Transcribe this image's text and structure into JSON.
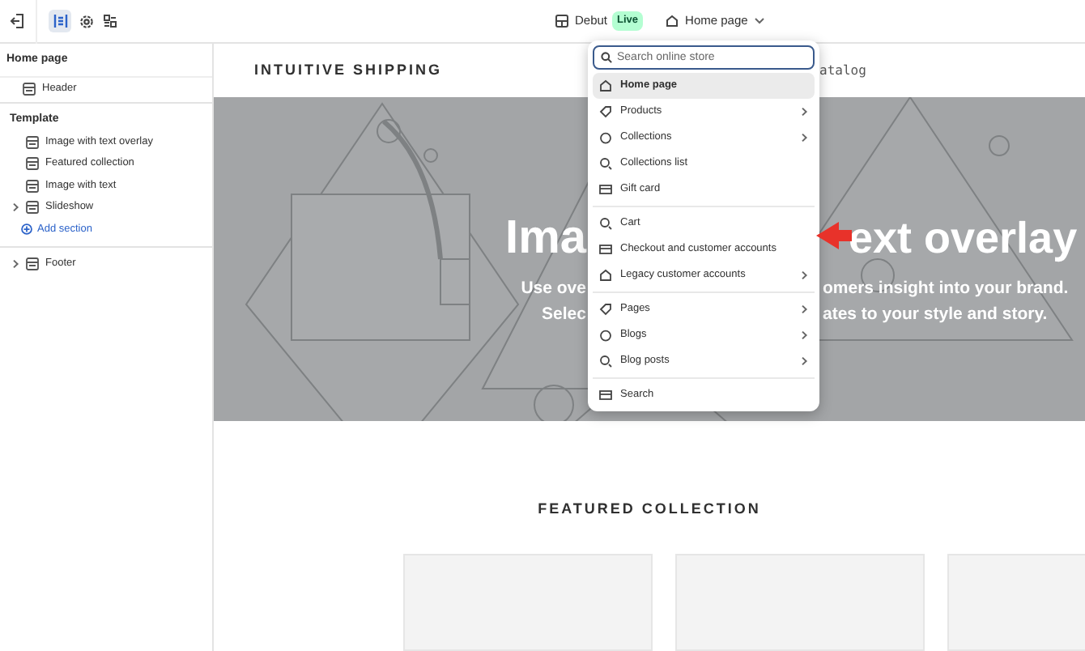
{
  "topbar": {
    "theme": "Debut",
    "badge": "Live",
    "page": "Home page"
  },
  "sidebar": {
    "title": "Home page",
    "header_item": "Header",
    "template_title": "Template",
    "sections": [
      {
        "label": "Image with text overlay",
        "expandable": false
      },
      {
        "label": "Featured collection",
        "expandable": false
      },
      {
        "label": "Image with text",
        "expandable": false
      },
      {
        "label": "Slideshow",
        "expandable": true
      }
    ],
    "add_section": "Add section",
    "footer": {
      "label": "Footer",
      "expandable": true
    }
  },
  "preview": {
    "store_name": "INTUITIVE SHIPPING",
    "nav_fragment": "atalog",
    "hero": {
      "title_left": "Ima",
      "title_right": "ext overlay",
      "lines": [
        {
          "left": "Use ove",
          "right": "omers insight into your brand."
        },
        {
          "left": "Selec",
          "right": "ates to your style and story."
        }
      ]
    },
    "featured_title": "FEATURED COLLECTION"
  },
  "menu": {
    "search_placeholder": "Search online store",
    "groups": [
      [
        {
          "label": "Home page",
          "submenu": false,
          "selected": true
        },
        {
          "label": "Products",
          "submenu": true,
          "selected": false
        },
        {
          "label": "Collections",
          "submenu": true,
          "selected": false
        },
        {
          "label": "Collections list",
          "submenu": false,
          "selected": false
        },
        {
          "label": "Gift card",
          "submenu": false,
          "selected": false
        }
      ],
      [
        {
          "label": "Cart",
          "submenu": false,
          "selected": false
        },
        {
          "label": "Checkout and customer accounts",
          "submenu": false,
          "selected": false
        },
        {
          "label": "Legacy customer accounts",
          "submenu": true,
          "selected": false
        }
      ],
      [
        {
          "label": "Pages",
          "submenu": true,
          "selected": false
        },
        {
          "label": "Blogs",
          "submenu": true,
          "selected": false
        },
        {
          "label": "Blog posts",
          "submenu": true,
          "selected": false
        }
      ],
      [
        {
          "label": "Search",
          "submenu": false,
          "selected": false
        }
      ]
    ]
  }
}
